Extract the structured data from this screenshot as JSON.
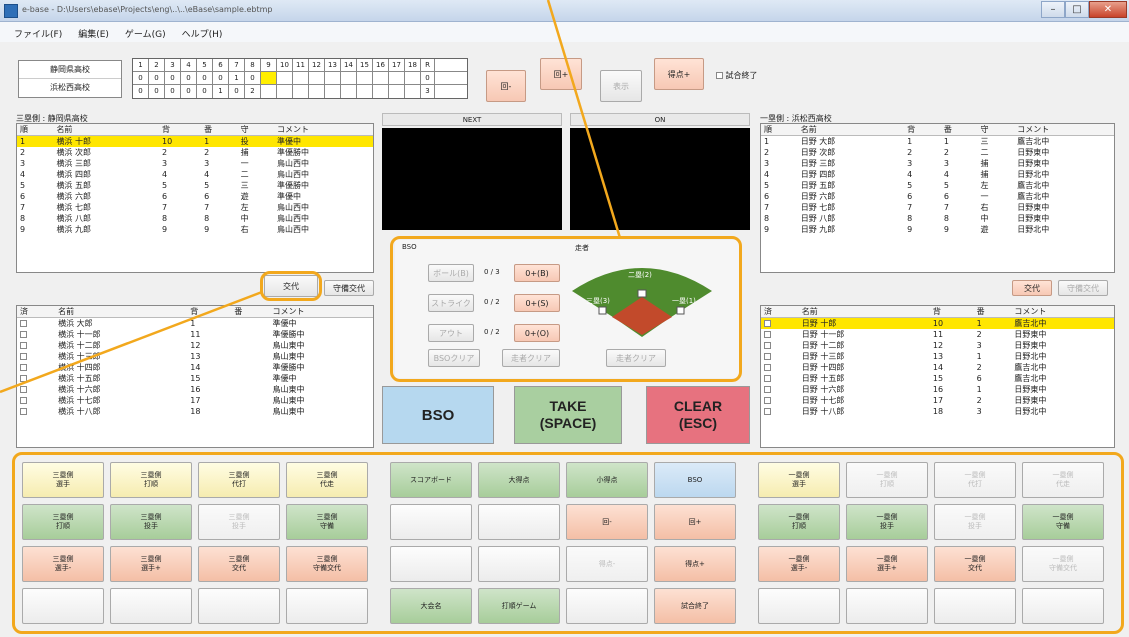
{
  "window": {
    "title": "e-base - D:\\Users\\ebase\\Projects\\eng\\..\\..\\eBase\\sample.ebtmp"
  },
  "menu": [
    "ファイル(F)",
    "編集(E)",
    "ゲーム(G)",
    "ヘルプ(H)"
  ],
  "score": {
    "teams": [
      "静岡県高校",
      "浜松西高校"
    ],
    "header": [
      "1",
      "2",
      "3",
      "4",
      "5",
      "6",
      "7",
      "8",
      "9",
      "10",
      "11",
      "12",
      "13",
      "14",
      "15",
      "16",
      "17",
      "18",
      "R"
    ],
    "rows": [
      [
        "0",
        "0",
        "0",
        "0",
        "0",
        "0",
        "1",
        "0",
        "",
        "",
        "",
        "",
        "",
        "",
        "",
        "",
        "",
        "",
        "0"
      ],
      [
        "0",
        "0",
        "0",
        "0",
        "0",
        "1",
        "0",
        "2",
        "",
        "",
        "",
        "",
        "",
        "",
        "",
        "",
        "",
        "",
        "3"
      ]
    ],
    "highlight": [
      0,
      8
    ]
  },
  "top_buttons": {
    "back": "回-",
    "forward": "回+",
    "out": "表示",
    "count": "得点+",
    "checkbox": "試合終了"
  },
  "left_panel": {
    "title": "三塁側 : 静岡県高校",
    "columns": [
      "順",
      "名前",
      "背",
      "番",
      "守",
      "コメント"
    ],
    "rows": [
      [
        "1",
        "横浜 十郎",
        "10",
        "1",
        "投",
        "準優中"
      ],
      [
        "2",
        "横浜 次郎",
        "2",
        "2",
        "捕",
        "準優勝中"
      ],
      [
        "3",
        "横浜 三郎",
        "3",
        "3",
        "一",
        "鳥山西中"
      ],
      [
        "4",
        "横浜 四郎",
        "4",
        "4",
        "二",
        "鳥山西中"
      ],
      [
        "5",
        "横浜 五郎",
        "5",
        "5",
        "三",
        "準優勝中"
      ],
      [
        "6",
        "横浜 六郎",
        "6",
        "6",
        "遊",
        "準優中"
      ],
      [
        "7",
        "横浜 七郎",
        "7",
        "7",
        "左",
        "鳥山西中"
      ],
      [
        "8",
        "横浜 八郎",
        "8",
        "8",
        "中",
        "鳥山西中"
      ],
      [
        "9",
        "横浜 九郎",
        "9",
        "9",
        "右",
        "鳥山西中"
      ]
    ],
    "btn_sub": "交代",
    "btn_tmp": "守備交代",
    "bench_columns": [
      "済",
      "名前",
      "背",
      "番",
      "コメント"
    ],
    "bench": [
      [
        "横浜 大郎",
        "1",
        "",
        "準優中"
      ],
      [
        "横浜 十一郎",
        "11",
        "",
        "準優勝中"
      ],
      [
        "横浜 十二郎",
        "12",
        "",
        "鳥山東中"
      ],
      [
        "横浜 十三郎",
        "13",
        "",
        "鳥山東中"
      ],
      [
        "横浜 十四郎",
        "14",
        "",
        "準優勝中"
      ],
      [
        "横浜 十五郎",
        "15",
        "",
        "準優中"
      ],
      [
        "横浜 十六郎",
        "16",
        "",
        "鳥山東中"
      ],
      [
        "横浜 十七郎",
        "17",
        "",
        "鳥山東中"
      ],
      [
        "横浜 十八郎",
        "18",
        "",
        "鳥山東中"
      ]
    ]
  },
  "middle": {
    "next_label": "NEXT",
    "on_label": "ON",
    "bso_title": "BSO",
    "runner_title": "走者",
    "bso_rows": [
      [
        "ボール(B)",
        "0 / 3",
        "0+(B)"
      ],
      [
        "ストライク",
        "0 / 2",
        "0+(S)"
      ],
      [
        "アウト",
        "0 / 2",
        "0+(O)"
      ]
    ],
    "clear_btn": "BSOクリア",
    "runner_btn": "走者クリア",
    "runner_clear": "走者クリア",
    "bases": {
      "second": "二塁(2)",
      "third": "三塁(3)",
      "first": "一塁(1)"
    },
    "big": {
      "bso": "BSO",
      "take": "TAKE\n(SPACE)",
      "clear": "CLEAR\n(ESC)"
    }
  },
  "right_panel": {
    "title": "一塁側 : 浜松西高校",
    "columns": [
      "順",
      "名前",
      "背",
      "番",
      "守",
      "コメント"
    ],
    "rows": [
      [
        "1",
        "日野 大郎",
        "1",
        "1",
        "三",
        "鷹吉北中"
      ],
      [
        "2",
        "日野 次郎",
        "2",
        "2",
        "二",
        "日野東中"
      ],
      [
        "3",
        "日野 三郎",
        "3",
        "3",
        "捕",
        "日野東中"
      ],
      [
        "4",
        "日野 四郎",
        "4",
        "4",
        "捕",
        "日野北中"
      ],
      [
        "5",
        "日野 五郎",
        "5",
        "5",
        "左",
        "鷹吉北中"
      ],
      [
        "6",
        "日野 六郎",
        "6",
        "6",
        "一",
        "鷹吉北中"
      ],
      [
        "7",
        "日野 七郎",
        "7",
        "7",
        "右",
        "日野東中"
      ],
      [
        "8",
        "日野 八郎",
        "8",
        "8",
        "中",
        "日野東中"
      ],
      [
        "9",
        "日野 九郎",
        "9",
        "9",
        "遊",
        "日野北中"
      ]
    ],
    "btn_sub": "交代",
    "btn_tmp": "守備交代",
    "bench_columns": [
      "済",
      "名前",
      "背",
      "番",
      "コメント"
    ],
    "bench": [
      [
        "日野 十郎",
        "10",
        "1",
        "鷹吉北中"
      ],
      [
        "日野 十一郎",
        "11",
        "2",
        "日野東中"
      ],
      [
        "日野 十二郎",
        "12",
        "3",
        "日野東中"
      ],
      [
        "日野 十三郎",
        "13",
        "1",
        "日野北中"
      ],
      [
        "日野 十四郎",
        "14",
        "2",
        "鷹吉北中"
      ],
      [
        "日野 十五郎",
        "15",
        "6",
        "鷹吉北中"
      ],
      [
        "日野 十六郎",
        "16",
        "1",
        "日野東中"
      ],
      [
        "日野 十七郎",
        "17",
        "2",
        "日野東中"
      ],
      [
        "日野 十八郎",
        "18",
        "3",
        "日野北中"
      ]
    ]
  },
  "bottom": {
    "left": [
      [
        "三塁側\n選手",
        "三塁側\n打順",
        "三塁側\n代打",
        "三塁側\n代走"
      ],
      [
        "三塁側\n打順",
        "三塁側\n投手",
        "三塁側\n投手",
        "三塁側\n守備"
      ],
      [
        "三塁側\n選手-",
        "三塁側\n選手+",
        "三塁側\n交代",
        "三塁側\n守備交代"
      ],
      [
        "",
        "",
        "",
        ""
      ]
    ],
    "mid": [
      [
        "スコアボード",
        "大得点",
        "小得点",
        "BSO"
      ],
      [
        "",
        "",
        "回-",
        "回+"
      ],
      [
        "",
        "",
        "得点-",
        "得点+"
      ],
      [
        "大会名",
        "打順ゲーム",
        "",
        "試合終了"
      ]
    ],
    "right": [
      [
        "一塁側\n選手",
        "一塁側\n打順",
        "一塁側\n代打",
        "一塁側\n代走"
      ],
      [
        "一塁側\n打順",
        "一塁側\n投手",
        "一塁側\n投手",
        "一塁側\n守備"
      ],
      [
        "一塁側\n選手-",
        "一塁側\n選手+",
        "一塁側\n交代",
        "一塁側\n守備交代"
      ],
      [
        "",
        "",
        "",
        ""
      ]
    ]
  },
  "colors": {
    "yellow": "#ffe600",
    "highlight": "#f2a81d",
    "bso_blue": "#b6d8ef",
    "take_green": "#a9cfa0",
    "clear_red": "#e7727f",
    "field_green": "#4f8b2e",
    "field_red": "#c24a2b"
  }
}
